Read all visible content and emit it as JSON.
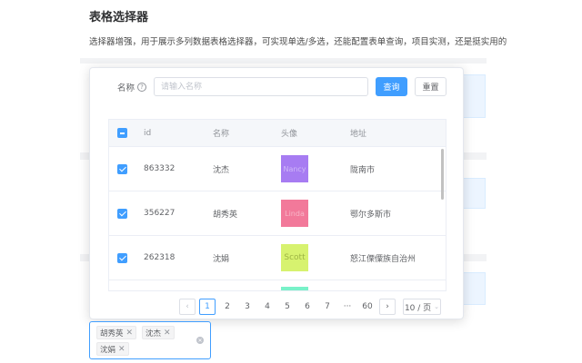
{
  "page": {
    "title": "表格选择器",
    "description": "选择器增强，用于展示多列数据表格选择器，可实现单选/多选，还能配置表单查询，项目实测，还是挺实用的"
  },
  "form": {
    "label": "名称",
    "help_icon": "question-circle-icon",
    "placeholder": "请输入名称",
    "search_label": "查询",
    "reset_label": "重置"
  },
  "table": {
    "headers": {
      "id": "id",
      "name": "名称",
      "avatar": "头像",
      "address": "地址"
    },
    "rows": [
      {
        "id": "863332",
        "name": "沈杰",
        "avatar_text": "Nancy",
        "avatar_color": "#a77cf2",
        "address": "陇南市"
      },
      {
        "id": "356227",
        "name": "胡秀英",
        "avatar_text": "Linda",
        "avatar_color": "#f2799a",
        "address": "鄂尔多斯市"
      },
      {
        "id": "262318",
        "name": "沈娟",
        "avatar_text": "Scott",
        "avatar_color": "#d7f26f",
        "address": "怒江傈僳族自治州"
      },
      {
        "id": "",
        "name": "",
        "avatar_text": "",
        "avatar_color": "#79f2c9",
        "address": ""
      }
    ]
  },
  "pager": {
    "prev_icon": "chevron-left-icon",
    "next_icon": "chevron-right-icon",
    "pages": [
      "1",
      "2",
      "3",
      "4",
      "5",
      "6",
      "7"
    ],
    "active": "1",
    "ellipsis": "···",
    "last": "60",
    "page_size": "10 / 页"
  },
  "select": {
    "tags": [
      "胡秀英",
      "沈杰",
      "沈娟"
    ],
    "close_glyph": "✕",
    "clear_icon": "close-circle-icon"
  },
  "colors": {
    "primary": "#409eff",
    "border": "#dcdfe6",
    "header_bg": "#f5f7fa"
  }
}
